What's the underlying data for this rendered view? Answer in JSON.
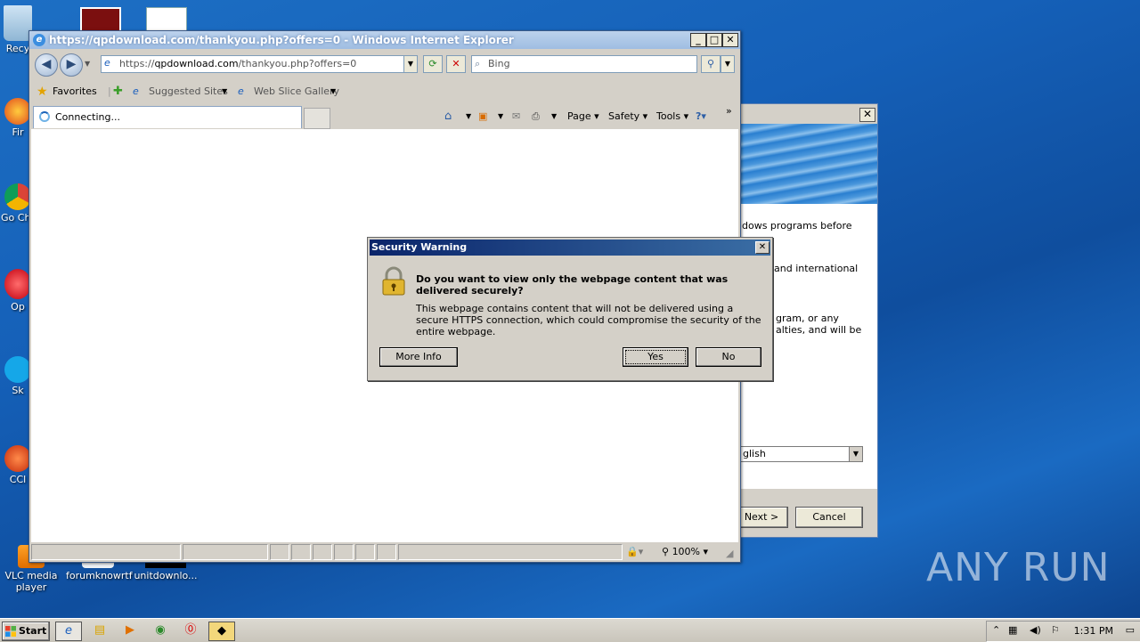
{
  "desktop": {
    "icons": [
      {
        "label": "Recy"
      },
      {
        "label": "Fir"
      },
      {
        "label": "Go Chr"
      },
      {
        "label": "Op"
      },
      {
        "label": "Sk"
      },
      {
        "label": "CCl"
      },
      {
        "label": "VLC media player"
      },
      {
        "label": "forumknowrtf"
      },
      {
        "label": "unitdownlo..."
      }
    ]
  },
  "wizard": {
    "lines": [
      "dows programs before",
      "and international",
      "gram, or any",
      "alties, and will be"
    ],
    "language_value": "glish",
    "next_label": "Next >",
    "cancel_label": "Cancel",
    "close_glyph": "✕"
  },
  "ie": {
    "title": "https://qpdownload.com/thankyou.php?offers=0 - Windows Internet Explorer",
    "address_prefix": "https://",
    "address_domain": "qpdownload.com",
    "address_path": "/thankyou.php?offers=0",
    "search_placeholder": "Bing",
    "favorites_label": "Favorites",
    "suggested_sites_label": "Suggested Sites",
    "web_slice_label": "Web Slice Gallery",
    "tab_label": "Connecting...",
    "commands": {
      "page": "Page",
      "safety": "Safety",
      "tools": "Tools"
    },
    "zoom": "100%"
  },
  "dialog": {
    "title": "Security Warning",
    "question": "Do you want to view only the webpage content that was delivered securely?",
    "description": "This webpage contains content that will not be delivered using a secure HTTPS connection, which could compromise the security of the entire webpage.",
    "more_info_label": "More Info",
    "yes_label": "Yes",
    "no_label": "No"
  },
  "taskbar": {
    "start_label": "Start",
    "clock": "1:31 PM"
  },
  "watermark": "ANY RUN"
}
